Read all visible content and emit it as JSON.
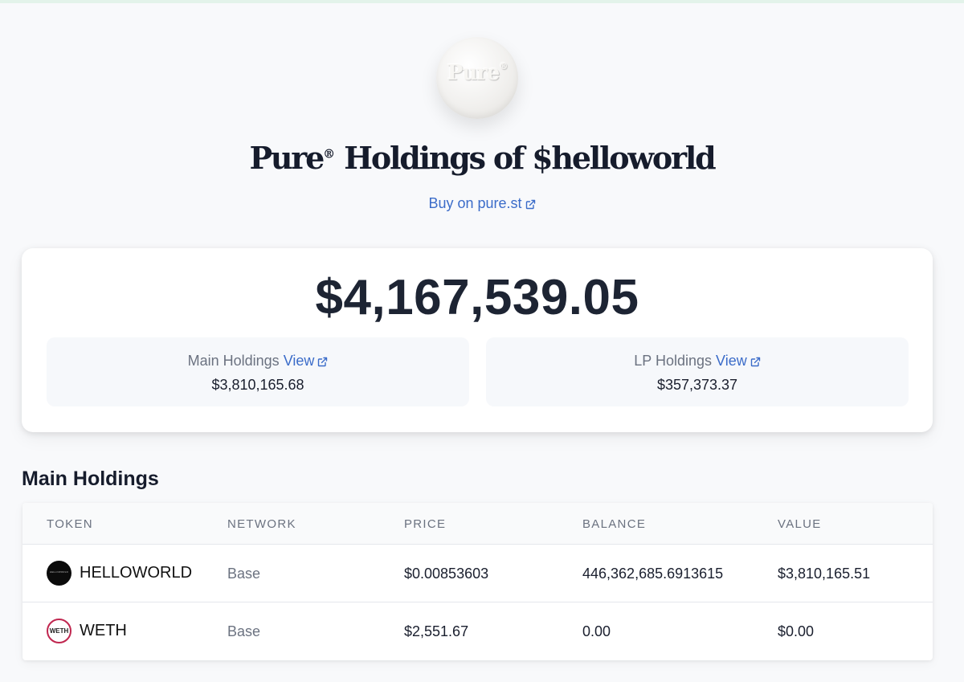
{
  "logo": {
    "text": "Pure",
    "reg": "®"
  },
  "header": {
    "title_brand": "Pure",
    "title_mark": "®",
    "title_rest": "Holdings of $helloworld",
    "buy_link": "Buy on pure.st"
  },
  "summary": {
    "total": "$4,167,539.05",
    "main": {
      "label": "Main Holdings",
      "view": "View",
      "value": "$3,810,165.68"
    },
    "lp": {
      "label": "LP Holdings",
      "view": "View",
      "value": "$357,373.37"
    }
  },
  "section": {
    "title": "Main Holdings"
  },
  "table": {
    "headers": {
      "token": "TOKEN",
      "network": "NETWORK",
      "price": "PRICE",
      "balance": "BALANCE",
      "value": "VALUE"
    },
    "rows": [
      {
        "icon": "helloworld-token-icon",
        "icon_text": "HELLOWORLD",
        "token": "HELLOWORLD",
        "network": "Base",
        "price": "$0.00853603",
        "balance": "446,362,685.6913615",
        "value": "$3,810,165.51"
      },
      {
        "icon": "weth-token-icon",
        "icon_text": "WETH",
        "token": "WETH",
        "network": "Base",
        "price": "$2,551.67",
        "balance": "0.00",
        "value": "$0.00"
      }
    ]
  },
  "colors": {
    "link": "#3b6cc9",
    "text": "#1a1f2e",
    "muted": "#6b7280",
    "background": "#f8f9fb",
    "weth_ring": "#c0264f"
  }
}
